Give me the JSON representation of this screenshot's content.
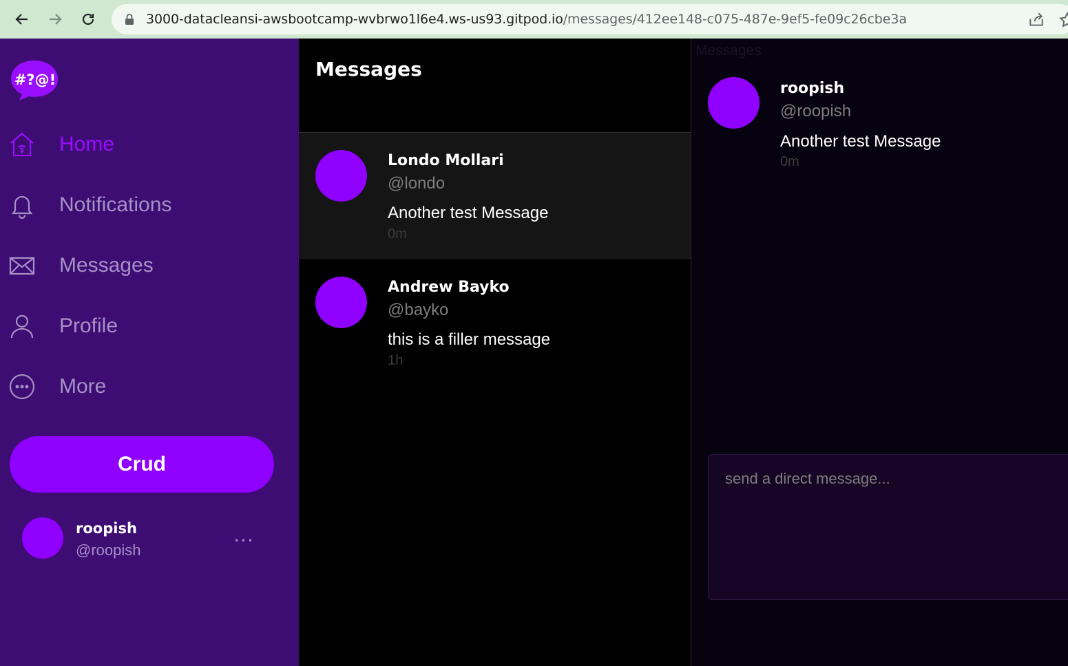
{
  "browser": {
    "url_host": "3000-datacleansi-awsbootcamp-wvbrwo1l6e4.ws-us93.gitpod.io",
    "url_path": "/messages/412ee148-c075-487e-9ef5-fe09c26cbe3a"
  },
  "sidebar": {
    "logo_text": "#?@!",
    "items": [
      {
        "label": "Home",
        "icon": "home-icon",
        "active": true
      },
      {
        "label": "Notifications",
        "icon": "bell-icon",
        "active": false
      },
      {
        "label": "Messages",
        "icon": "mail-icon",
        "active": false
      },
      {
        "label": "Profile",
        "icon": "user-icon",
        "active": false
      },
      {
        "label": "More",
        "icon": "more-circle-icon",
        "active": false
      }
    ],
    "crud_label": "Crud",
    "user": {
      "name": "roopish",
      "handle": "@roopish",
      "more": "..."
    }
  },
  "middle": {
    "title": "Messages",
    "groups": [
      {
        "name": "Londo Mollari",
        "handle": "@londo",
        "message": "Another test Message",
        "time": "0m",
        "selected": true
      },
      {
        "name": "Andrew Bayko",
        "handle": "@bayko",
        "message": "this is a filler message",
        "time": "1h",
        "selected": false
      }
    ]
  },
  "right": {
    "ghost_title": "Messages",
    "messages": [
      {
        "name": "roopish",
        "handle": "@roopish",
        "message": "Another test Message",
        "time": "0m"
      }
    ],
    "input_placeholder": "send a direct message..."
  },
  "colors": {
    "sidebar_bg": "#3d0d74",
    "accent": "#9000ff",
    "muted_text": "#a88fc6",
    "browser_bar": "#cfe8cf"
  }
}
